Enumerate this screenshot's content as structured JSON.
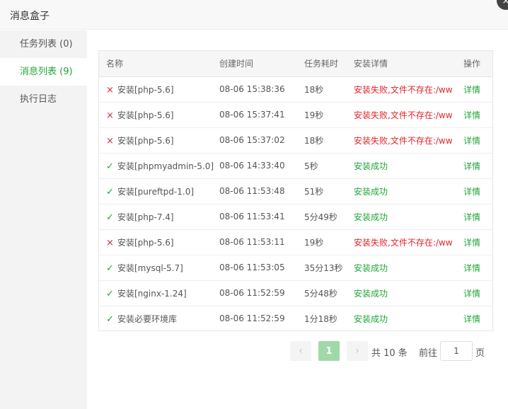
{
  "dialog": {
    "title": "消息盒子",
    "close_glyph": "×"
  },
  "sidebar": {
    "items": [
      {
        "label": "任务列表 (0)",
        "active": false
      },
      {
        "label": "消息列表 (9)",
        "active": true
      },
      {
        "label": "执行日志",
        "active": false
      }
    ]
  },
  "table": {
    "headers": {
      "name": "名称",
      "time": "创建时间",
      "duration": "任务耗时",
      "detail": "安装详情",
      "op": "操作"
    },
    "rows": [
      {
        "status": "fail",
        "name": "安装[php-5.6]",
        "time": "08-06 15:38:36",
        "duration": "18秒",
        "detail": "安装失败,文件不存在:/ww",
        "op": "详情"
      },
      {
        "status": "fail",
        "name": "安装[php-5.6]",
        "time": "08-06 15:37:41",
        "duration": "19秒",
        "detail": "安装失败,文件不存在:/ww",
        "op": "详情"
      },
      {
        "status": "fail",
        "name": "安装[php-5.6]",
        "time": "08-06 15:37:02",
        "duration": "18秒",
        "detail": "安装失败,文件不存在:/ww",
        "op": "详情"
      },
      {
        "status": "ok",
        "name": "安装[phpmyadmin-5.0]",
        "time": "08-06 14:33:40",
        "duration": "5秒",
        "detail": "安装成功",
        "op": "详情"
      },
      {
        "status": "ok",
        "name": "安装[pureftpd-1.0]",
        "time": "08-06 11:53:48",
        "duration": "51秒",
        "detail": "安装成功",
        "op": "详情"
      },
      {
        "status": "ok",
        "name": "安装[php-7.4]",
        "time": "08-06 11:53:41",
        "duration": "5分49秒",
        "detail": "安装成功",
        "op": "详情"
      },
      {
        "status": "fail",
        "name": "安装[php-5.6]",
        "time": "08-06 11:53:11",
        "duration": "19秒",
        "detail": "安装失败,文件不存在:/ww",
        "op": "详情"
      },
      {
        "status": "ok",
        "name": "安装[mysql-5.7]",
        "time": "08-06 11:53:05",
        "duration": "35分13秒",
        "detail": "安装成功",
        "op": "详情"
      },
      {
        "status": "ok",
        "name": "安装[nginx-1.24]",
        "time": "08-06 11:52:59",
        "duration": "5分48秒",
        "detail": "安装成功",
        "op": "详情"
      },
      {
        "status": "ok",
        "name": "安装必要环境库",
        "time": "08-06 11:52:59",
        "duration": "1分18秒",
        "detail": "安装成功",
        "op": "详情"
      }
    ]
  },
  "icons": {
    "fail": "×",
    "ok": "✓"
  },
  "pagination": {
    "prev_glyph": "‹",
    "current_page": "1",
    "next_glyph": "›",
    "total_text": "共 10 条",
    "goto_label": "前往",
    "goto_value": "1",
    "page_unit": "页"
  },
  "colors": {
    "accent": "#20a53a",
    "error": "#e0262b",
    "pager_active": "#9fd9a8"
  }
}
